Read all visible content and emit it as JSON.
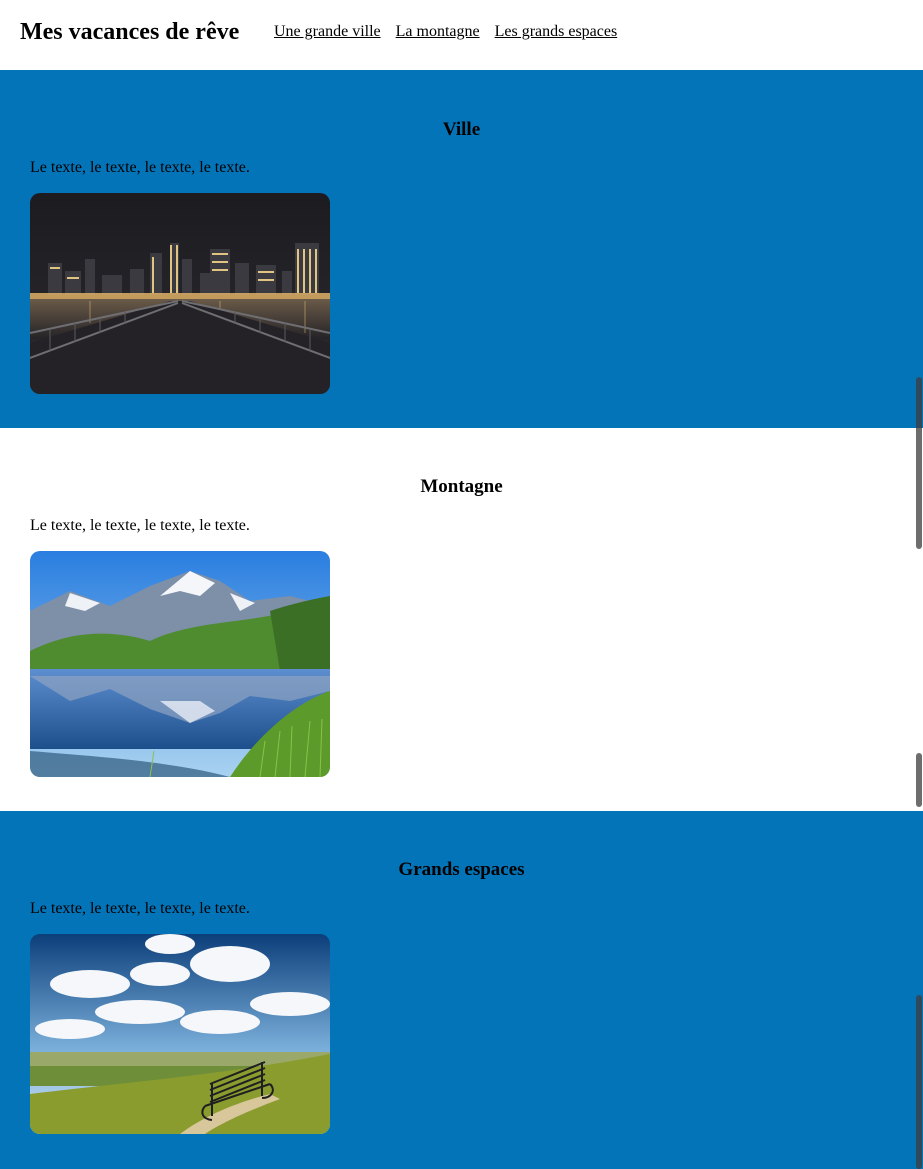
{
  "header": {
    "title": "Mes vacances de rêve",
    "nav": [
      "Une grande ville",
      "La montagne",
      "Les grands espaces"
    ]
  },
  "sections": [
    {
      "title": "Ville",
      "text": "Le texte, le texte, le texte, le texte.",
      "image": "city-night-skyline-image"
    },
    {
      "title": "Montagne",
      "text": "Le texte, le texte, le texte, le texte.",
      "image": "mountain-lake-image"
    },
    {
      "title": "Grands espaces",
      "text": "Le texte, le texte, le texte, le texte.",
      "image": "bench-landscape-image"
    }
  ],
  "colors": {
    "section_blue": "#0474b9",
    "section_white": "#ffffff"
  }
}
